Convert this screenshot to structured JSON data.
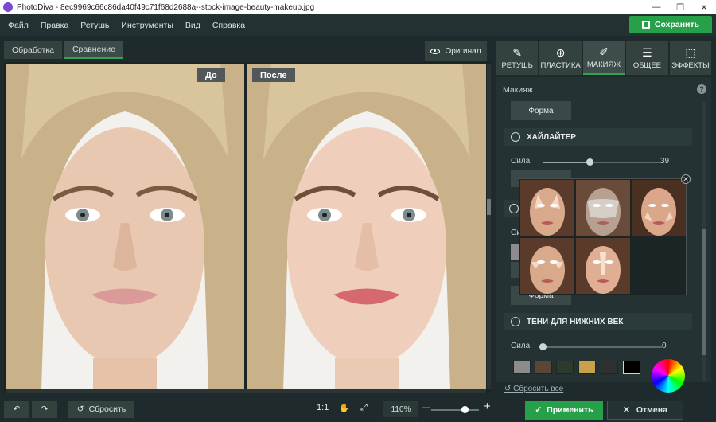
{
  "window": {
    "title": "PhotoDiva - 8ec9969c66c86da40f49c71f68d2688a--stock-image-beauty-makeup.jpg",
    "minimize": "—",
    "maximize": "❐",
    "close": "✕"
  },
  "menu": [
    "Файл",
    "Правка",
    "Ретушь",
    "Инструменты",
    "Вид",
    "Справка"
  ],
  "save_label": "Сохранить",
  "mode_tabs": [
    {
      "label": "Обработка"
    },
    {
      "label": "Сравнение",
      "active": true
    }
  ],
  "original_label": "Оригинал",
  "labels": {
    "before": "До",
    "after": "После"
  },
  "tool_tabs": [
    {
      "label": "РЕТУШЬ",
      "icon": "✎"
    },
    {
      "label": "ПЛАСТИКА",
      "icon": "⊕"
    },
    {
      "label": "МАКИЯЖ",
      "icon": "✐",
      "active": true
    },
    {
      "label": "ОБЩЕЕ",
      "icon": "☰"
    },
    {
      "label": "ЭФФЕКТЫ",
      "icon": "⬚"
    }
  ],
  "panel": {
    "title": "Макияж",
    "help": "?",
    "forma1": "Форма",
    "highlighter": {
      "title": "ХАЙЛАЙТЕР",
      "sila_label": "Сила",
      "sila_value": "39",
      "level": 0.39
    },
    "sila_partial": "Си",
    "forma2": "Форма",
    "lower_shadow": {
      "title": "ТЕНИ ДЛЯ НИЖНИХ ВЕК",
      "sila_label": "Сила",
      "sila_value": "0",
      "level": 0
    },
    "swatches": [
      "#8c8c8c",
      "#5a4634",
      "#2f3b2a",
      "#c8a24a",
      "#2e3130",
      "#000000"
    ],
    "reset_label": "Сбросить все"
  },
  "bottom": {
    "reset": "Сбросить",
    "ratio": "1:1",
    "zoom": "110%",
    "minus": "—",
    "plus": "+"
  },
  "apply_label": "Применить",
  "cancel_label": "Отмена",
  "colors": {
    "accent": "#27a04a",
    "panel": "#253234",
    "bg": "#1f2a2c"
  }
}
